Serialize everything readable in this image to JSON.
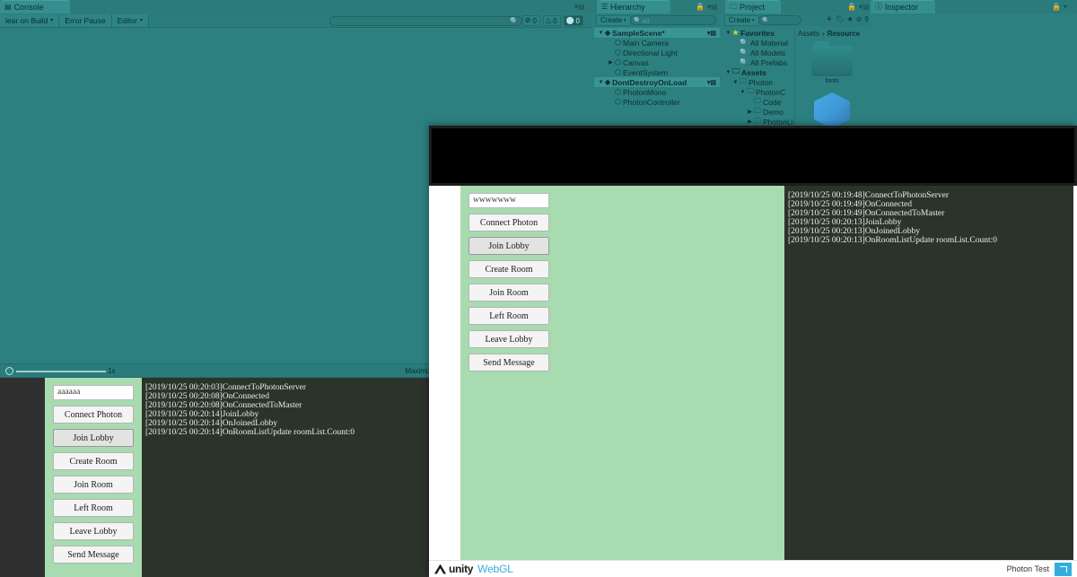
{
  "editor": {
    "tabs": [
      {
        "label": "Console",
        "icon": "console-icon"
      },
      {
        "label": "Hierarchy",
        "icon": "hierarchy-icon"
      },
      {
        "label": "Project",
        "icon": "project-icon"
      },
      {
        "label": "Inspector",
        "icon": "info-icon"
      }
    ],
    "console": {
      "toolbar_buttons": [
        "lear on Build",
        "Error Pause",
        "Editor"
      ],
      "search_placeholder": "",
      "counters": [
        {
          "icon": "error-icon",
          "count": "0",
          "active": false
        },
        {
          "icon": "warning-icon",
          "count": "0",
          "active": false
        },
        {
          "icon": "info-icon",
          "count": "0",
          "active": true
        }
      ]
    },
    "hierarchy": {
      "create_label": "Create",
      "search_placeholder": "All",
      "rows": [
        {
          "label": "SampleScene*",
          "depth": 0,
          "arrow": "▼",
          "icon": "scene-icon",
          "selected": true,
          "menu": true
        },
        {
          "label": "Main Camera",
          "depth": 1,
          "arrow": "",
          "icon": "gameobject-icon",
          "selected": false,
          "menu": false
        },
        {
          "label": "Directional Light",
          "depth": 1,
          "arrow": "",
          "icon": "gameobject-icon",
          "selected": false,
          "menu": false
        },
        {
          "label": "Canvas",
          "depth": 1,
          "arrow": "▶",
          "icon": "gameobject-icon",
          "selected": false,
          "menu": false
        },
        {
          "label": "EventSystem",
          "depth": 1,
          "arrow": "",
          "icon": "gameobject-icon",
          "selected": false,
          "menu": false
        },
        {
          "label": "DontDestroyOnLoad",
          "depth": 0,
          "arrow": "▼",
          "icon": "scene-icon",
          "selected": true,
          "menu": true
        },
        {
          "label": "PhotonMono",
          "depth": 1,
          "arrow": "",
          "icon": "gameobject-icon",
          "selected": false,
          "menu": false
        },
        {
          "label": "PhotonController",
          "depth": 1,
          "arrow": "",
          "icon": "gameobject-icon",
          "selected": false,
          "menu": false
        }
      ]
    },
    "project": {
      "create_label": "Create",
      "search_placeholder": "",
      "toolbar_icons": [
        "filter-icon",
        "label-icon",
        "star-icon",
        "hidden-icon"
      ],
      "hidden_count": "9",
      "breadcrumb": [
        "Assets",
        "Resource"
      ],
      "rows": [
        {
          "label": "Favorites",
          "depth": 0,
          "arrow": "▼",
          "icon": "star-icon",
          "bold": true
        },
        {
          "label": "All Material",
          "depth": 1,
          "arrow": "",
          "icon": "search-icon",
          "bold": false
        },
        {
          "label": "All Models",
          "depth": 1,
          "arrow": "",
          "icon": "search-icon",
          "bold": false
        },
        {
          "label": "All Prefabs",
          "depth": 1,
          "arrow": "",
          "icon": "search-icon",
          "bold": false
        },
        {
          "label": "Assets",
          "depth": 0,
          "arrow": "▼",
          "icon": "folder-icon",
          "bold": true
        },
        {
          "label": "Photon",
          "depth": 1,
          "arrow": "▼",
          "icon": "folder-icon",
          "bold": false
        },
        {
          "label": "PhotonC",
          "depth": 2,
          "arrow": "▼",
          "icon": "folder-icon",
          "bold": false
        },
        {
          "label": "Code",
          "depth": 3,
          "arrow": "",
          "icon": "folder-icon",
          "bold": false
        },
        {
          "label": "Demo",
          "depth": 3,
          "arrow": "▶",
          "icon": "folder-icon",
          "bold": false
        },
        {
          "label": "PhotonLi",
          "depth": 3,
          "arrow": "▶",
          "icon": "folder-icon",
          "bold": false
        }
      ],
      "assets": [
        {
          "label": "fonts",
          "icon": "folder-icon"
        },
        {
          "label": "",
          "icon": "prefab-cube-icon"
        }
      ]
    },
    "gameview": {
      "slider_value": "1x",
      "maximize_label": "Maximize"
    }
  },
  "front_game": {
    "name_input_value": "wwwwwww",
    "buttons": [
      {
        "label": "Connect Photon",
        "hover": false
      },
      {
        "label": "Join Lobby",
        "hover": true
      },
      {
        "label": "Create Room",
        "hover": false
      },
      {
        "label": "Join Room",
        "hover": false
      },
      {
        "label": "Left Room",
        "hover": false
      },
      {
        "label": "Leave Lobby",
        "hover": false
      },
      {
        "label": "Send Message",
        "hover": false
      }
    ],
    "log_lines": [
      "[2019/10/25 00:19:48]ConnectToPhotonServer",
      "[2019/10/25 00:19:49]OnConnected",
      "[2019/10/25 00:19:49]OnConnectedToMaster",
      "[2019/10/25 00:20:13]JoinLobby",
      "[2019/10/25 00:20:13]OnJoinedLobby",
      "[2019/10/25 00:20:13]OnRoomListUpdate roomList.Count:0"
    ]
  },
  "back_game": {
    "name_input_value": "aaaaaa",
    "buttons": [
      {
        "label": "Connect Photon",
        "hover": false
      },
      {
        "label": "Join Lobby",
        "hover": true
      },
      {
        "label": "Create Room",
        "hover": false
      },
      {
        "label": "Join Room",
        "hover": false
      },
      {
        "label": "Left Room",
        "hover": false
      },
      {
        "label": "Leave Lobby",
        "hover": false
      },
      {
        "label": "Send Message",
        "hover": false
      }
    ],
    "log_lines": [
      "[2019/10/25 00:20:03]ConnectToPhotonServer",
      "[2019/10/25 00:20:08]OnConnected",
      "[2019/10/25 00:20:08]OnConnectedToMaster",
      "[2019/10/25 00:20:14]JoinLobby",
      "[2019/10/25 00:20:14]OnJoinedLobby",
      "[2019/10/25 00:20:14]OnRoomListUpdate roomList.Count:0"
    ]
  },
  "browser_footer": {
    "logo_text": "unity",
    "product_text": "WebGL",
    "build_label": "Photon Test",
    "fullscreen_icon": "fullscreen-icon"
  },
  "colors": {
    "editor_bg": "#2d8080",
    "game_green": "#a8dbb0",
    "log_bg": "#2b332b",
    "accent_blue": "#33adde"
  }
}
